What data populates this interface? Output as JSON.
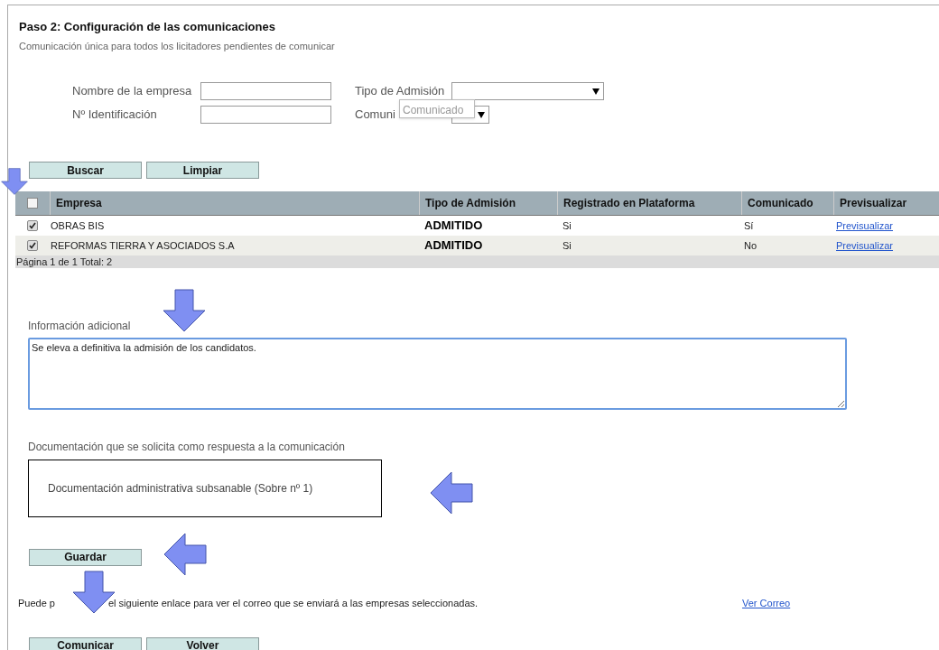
{
  "title": "Paso 2: Configuración de las comunicaciones",
  "subtitle": "Comunicación única para todos los licitadores pendientes de comunicar",
  "filters": {
    "company_name_label": "Nombre de la empresa",
    "id_label": "Nº Identificación",
    "admission_label": "Tipo de Admisión",
    "communicated_label": "Comuni",
    "tooltip": "Comunicado"
  },
  "search_buttons": [
    "Buscar",
    "Limpiar"
  ],
  "table": {
    "select_all_checked": false,
    "columns": [
      "Empresa",
      "Tipo de Admisión",
      "Registrado en Plataforma",
      "Comunicado",
      "Previsualizar"
    ],
    "rows": [
      {
        "checked": true,
        "empresa": "OBRAS BIS",
        "tipo": "ADMITIDO",
        "registrado": "Si",
        "comunicado": "Sí",
        "link": "Previsualizar"
      },
      {
        "checked": true,
        "empresa": "REFORMAS TIERRA Y ASOCIADOS S.A",
        "tipo": "ADMITIDO",
        "registrado": "Si",
        "comunicado": "No",
        "link": "Previsualizar"
      }
    ],
    "pager": "Página 1 de 1  Total: 2"
  },
  "additional_info": {
    "label": "Información adicional",
    "value": "Se eleva a definitiva la admisión de los candidatos."
  },
  "documentation": {
    "label": "Documentación que se solicita como respuesta a la comunicación",
    "item": "Documentación administrativa subsanable (Sobre nº 1)"
  },
  "save_button": "Guardar",
  "mail_note": [
    "Puede p",
    "el siguiente enlace para ver el correo que se enviará a las empresas seleccionadas."
  ],
  "mail_link": "Ver Correo",
  "bottom_buttons": [
    "Comunicar",
    "Volver"
  ]
}
